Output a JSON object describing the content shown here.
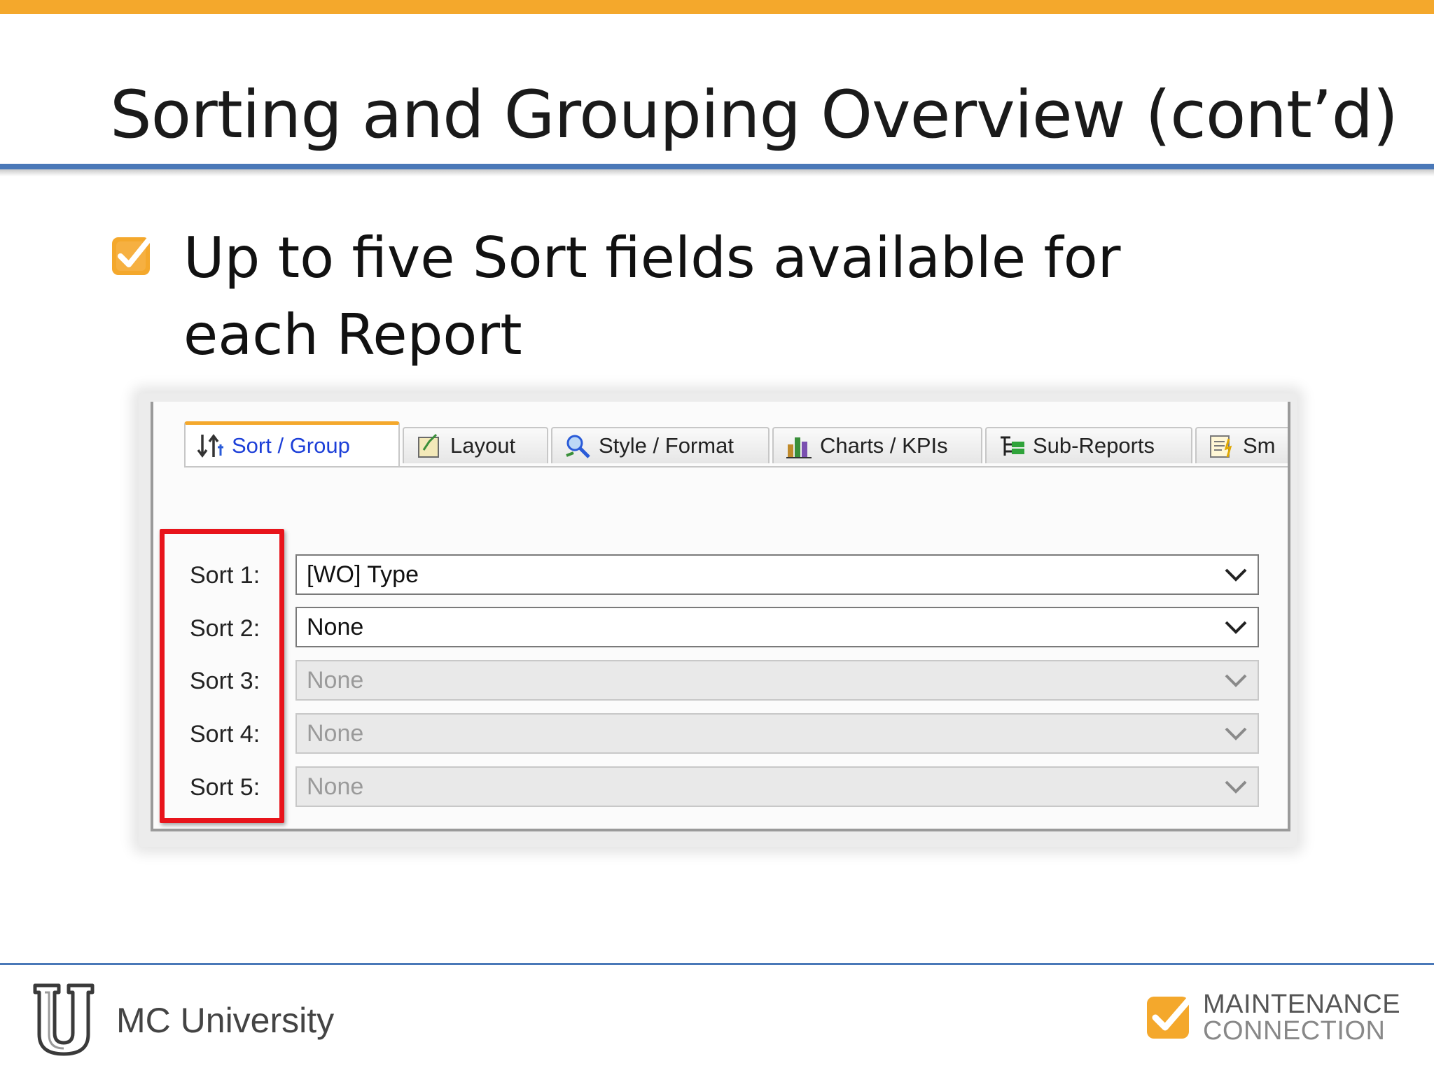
{
  "slide": {
    "title": "Sorting and Grouping Overview (cont’d)",
    "bullet_text": "Up to five Sort fields available for each Report"
  },
  "tabs": [
    {
      "label": "Sort / Group",
      "icon": "sort-arrows-icon",
      "active": true
    },
    {
      "label": "Layout",
      "icon": "layout-icon"
    },
    {
      "label": "Style / Format",
      "icon": "style-format-icon"
    },
    {
      "label": "Charts / KPIs",
      "icon": "charts-kpis-icon"
    },
    {
      "label": "Sub-Reports",
      "icon": "sub-reports-icon"
    },
    {
      "label": "Sm",
      "icon": "smart-icon"
    }
  ],
  "sorts": [
    {
      "label": "Sort 1:",
      "value": "[WO] Type",
      "enabled": true
    },
    {
      "label": "Sort 2:",
      "value": "None",
      "enabled": true
    },
    {
      "label": "Sort 3:",
      "value": "None",
      "enabled": false
    },
    {
      "label": "Sort 4:",
      "value": "None",
      "enabled": false
    },
    {
      "label": "Sort 5:",
      "value": "None",
      "enabled": false
    }
  ],
  "footer": {
    "left_text": "MC University",
    "brand_line1": "MAINTENANCE",
    "brand_line2": "CONNECTION"
  },
  "colors": {
    "accent_orange": "#F4A82C",
    "rule_blue": "#4A78B8",
    "highlight_red": "#E8141B",
    "active_tab_text": "#1C3FD8"
  }
}
